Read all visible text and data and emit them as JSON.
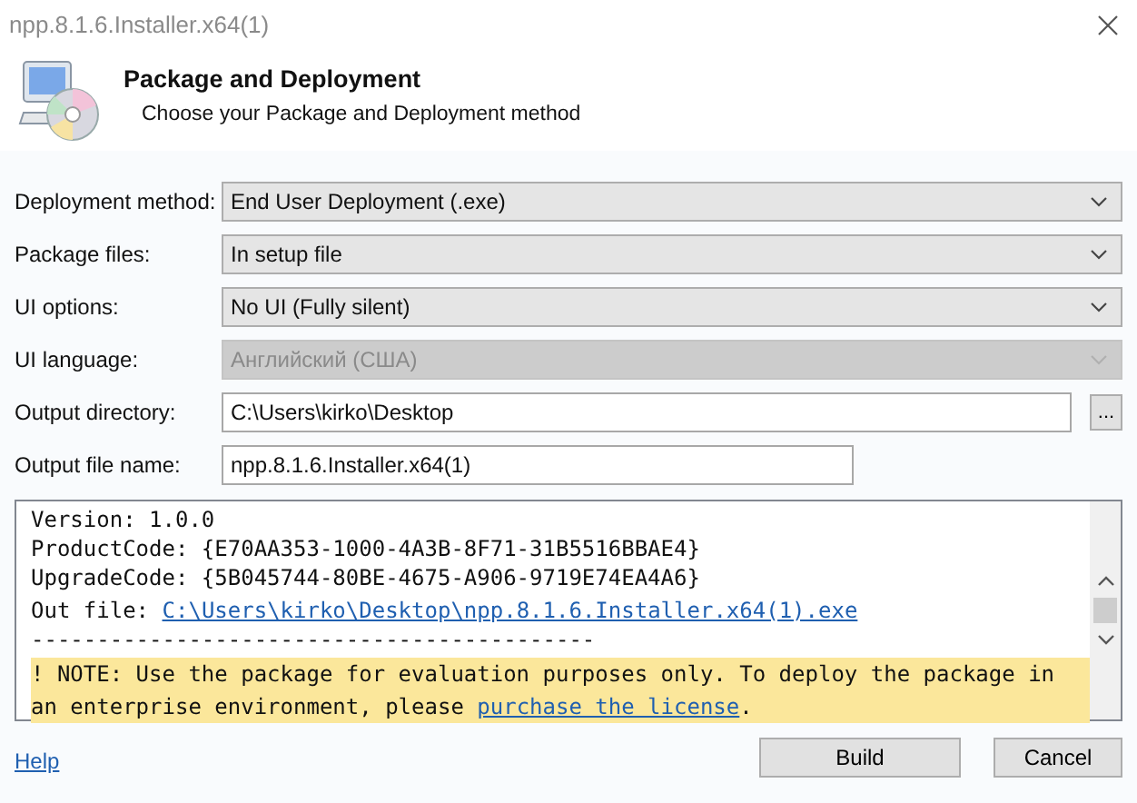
{
  "window": {
    "title": "npp.8.1.6.Installer.x64(1)"
  },
  "header": {
    "title": "Package and Deployment",
    "subtitle": "Choose your Package and Deployment method"
  },
  "fields": [
    {
      "kind": "combo",
      "label": "Deployment method:",
      "value": "End User Deployment (.exe)",
      "disabled": false
    },
    {
      "kind": "combo",
      "label": "Package files:",
      "value": "In setup file",
      "disabled": false
    },
    {
      "kind": "combo",
      "label": "UI options:",
      "value": "No UI (Fully silent)",
      "disabled": false
    },
    {
      "kind": "combo",
      "label": "UI language:",
      "value": "Английский (США)",
      "disabled": true
    },
    {
      "kind": "browse",
      "label": "Output directory:",
      "value": "C:\\Users\\kirko\\Desktop",
      "button": "..."
    },
    {
      "kind": "text",
      "label": "Output file name:",
      "value": "npp.8.1.6.Installer.x64(1)"
    }
  ],
  "log": {
    "lines": [
      {
        "kind": "text",
        "text": "Version: 1.0.0"
      },
      {
        "kind": "text",
        "text": "ProductCode: {E70AA353-1000-4A3B-8F71-31B5516BBAE4}"
      },
      {
        "kind": "text",
        "text": "UpgradeCode: {5B045744-80BE-4675-A906-9719E74EA4A6}"
      },
      {
        "kind": "link",
        "text": "Out file:",
        "link": "C:\\Users\\kirko\\Desktop\\npp.8.1.6.Installer.x64(1).exe"
      },
      {
        "kind": "separator",
        "text": "-------------------------------------------"
      },
      {
        "kind": "note",
        "text": "! NOTE: Use the package for evaluation purposes only. To deploy the package in an enterprise environment, please",
        "link": "purchase the license",
        "after": "."
      }
    ]
  },
  "footer": {
    "help": "Help",
    "buttons": [
      "Build",
      "Cancel"
    ]
  }
}
